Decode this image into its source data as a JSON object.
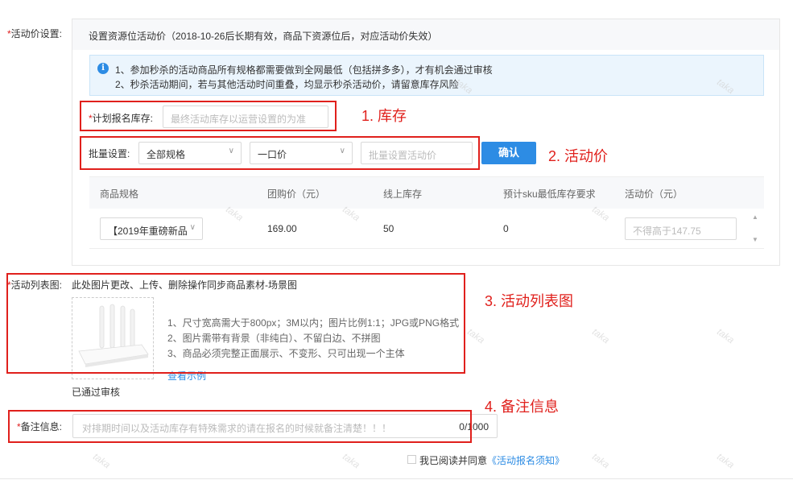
{
  "price_section": {
    "label_req": "*",
    "label": "活动价设置:",
    "desc": "设置资源位活动价（2018-10-26后长期有效，商品下资源位后，对应活动价失效）",
    "info_icon": "info-icon",
    "info_lines": [
      "1、参加秒杀的活动商品所有规格都需要做到全网最低（包括拼多多），才有机会通过审核",
      "2、秒杀活动期间，若与其他活动时间重叠，均显示秒杀活动价，请留意库存风险"
    ],
    "stock": {
      "label_req": "*",
      "label": "计划报名库存:",
      "placeholder": "最终活动库存以运营设置的为准"
    },
    "batch": {
      "label": "批量设置:",
      "spec_select": "全部规格",
      "price_type_select": "一口价",
      "price_placeholder": "批量设置活动价",
      "confirm": "确认"
    },
    "table": {
      "headers": [
        "商品规格",
        "团购价（元）",
        "线上库存",
        "预计sku最低库存要求",
        "活动价（元）"
      ],
      "rows": [
        {
          "spec": "【2019年重磅新品",
          "group_price": "169.00",
          "online_stock": "50",
          "min_stock": "0",
          "price_placeholder": "不得高于147.75"
        }
      ]
    }
  },
  "list_image_section": {
    "label_req": "*",
    "label": "活动列表图:",
    "desc": "此处图片更改、上传、删除操作同步商品素材-场景图",
    "tips": [
      "1、尺寸宽高需大于800px；3M以内；图片比例1:1；JPG或PNG格式",
      "2、图片需带有背景（非纯白）、不留白边、不拼图",
      "3、商品必须完整正面展示、不变形、只可出现一个主体"
    ],
    "view_example": "查看示例",
    "status": "已通过审核"
  },
  "remark_section": {
    "label_req": "*",
    "label": "备注信息:",
    "placeholder": "对排期时间以及活动库存有特殊需求的请在报名的时候就备注清楚！！！",
    "counter": "0/1000"
  },
  "agreement": {
    "prefix": "我已阅读并同意",
    "link": "《活动报名须知》"
  },
  "annotations": {
    "a1": "1. 库存",
    "a2": "2. 活动价",
    "a3": "3. 活动列表图",
    "a4": "4. 备注信息"
  },
  "watermark_text": "taka",
  "colors": {
    "primary": "#2d8ce4",
    "annotation_red": "#e0201c",
    "required_red": "#e02020",
    "info_bg": "#ebf5fd"
  }
}
